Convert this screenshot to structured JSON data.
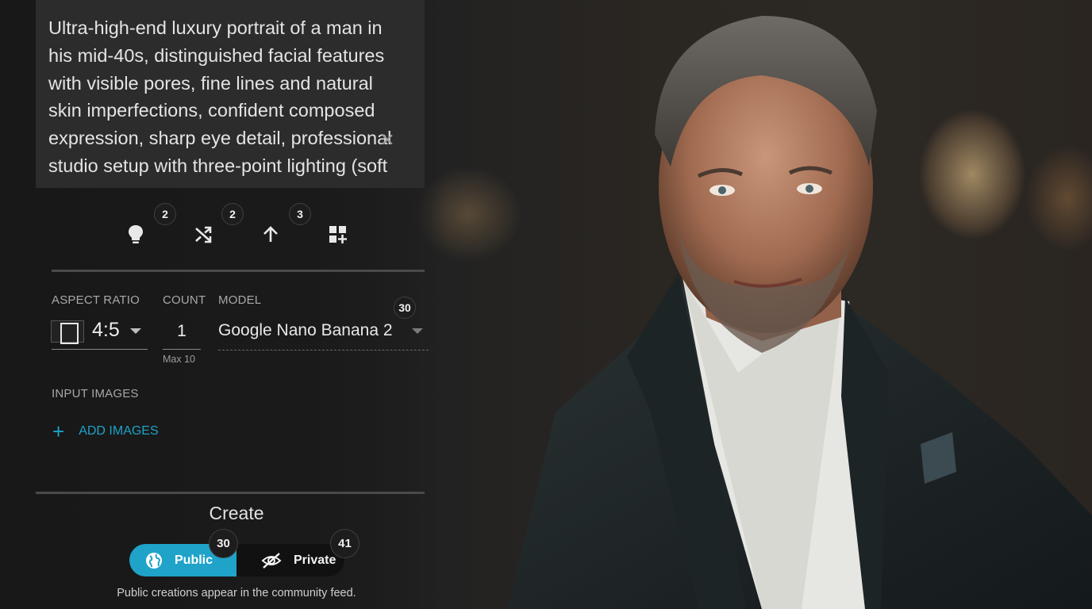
{
  "prompt": {
    "text": "Ultra-high-end luxury portrait of a man in his mid-40s, distinguished facial features with visible pores, fine lines and natural skin imperfections, confident composed expression, sharp eye detail, professional studio setup with three-point lighting (soft",
    "clear_icon": "close-icon"
  },
  "toolbar": {
    "items": [
      {
        "icon": "lightbulb-icon",
        "badge": "2"
      },
      {
        "icon": "shuffle-icon",
        "badge": "2"
      },
      {
        "icon": "arrow-up-icon",
        "badge": "3"
      },
      {
        "icon": "add-grid-icon",
        "badge": ""
      }
    ]
  },
  "settings": {
    "aspect_ratio": {
      "label": "ASPECT RATIO",
      "value": "4:5"
    },
    "count": {
      "label": "COUNT",
      "value": "1",
      "helper": "Max 10"
    },
    "model": {
      "label": "MODEL",
      "value": "Google Nano Banana 2",
      "badge": "30"
    }
  },
  "input_images": {
    "label": "INPUT IMAGES",
    "add_label": "ADD IMAGES"
  },
  "create": {
    "title": "Create",
    "public_label": "Public",
    "public_badge": "30",
    "private_label": "Private",
    "private_badge": "41",
    "hint": "Public creations appear in the community feed."
  },
  "colors": {
    "accent": "#1fa3c9",
    "panel": "#1b1b1b",
    "prompt_bg": "#2c2c2c"
  }
}
